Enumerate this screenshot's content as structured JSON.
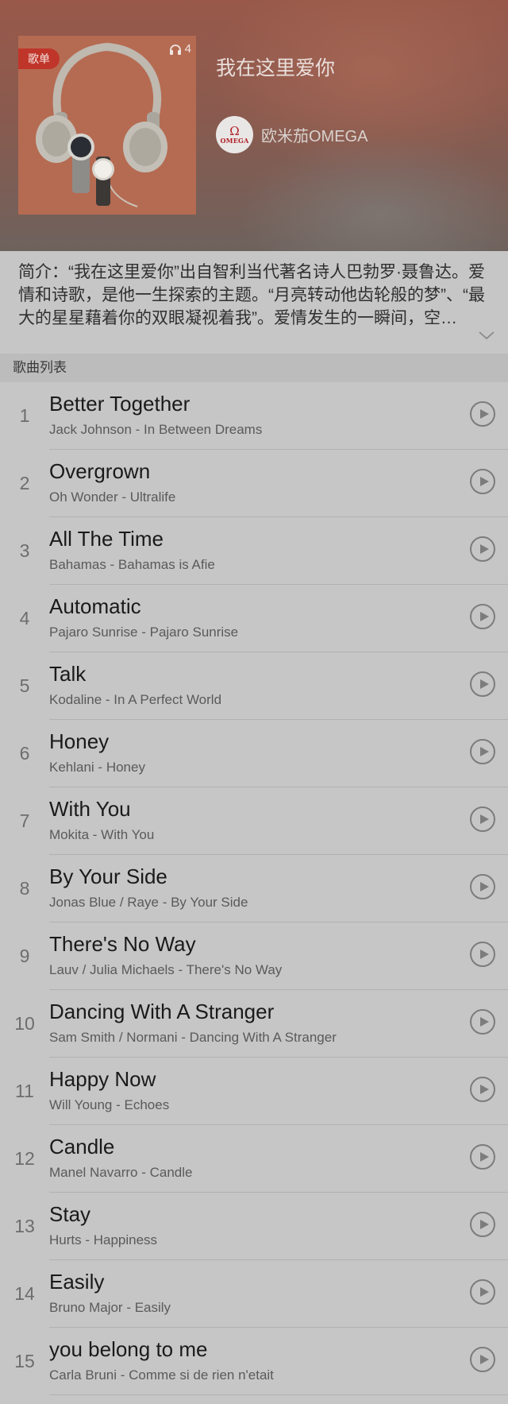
{
  "playlist": {
    "badge": "歌单",
    "listen_count": "4",
    "title": "我在这里爱你",
    "creator": "欧米茄OMEGA",
    "avatar_logo": "OMEGA",
    "description": "简介：“我在这里爱你”出自智利当代著名诗人巴勃罗·聂鲁达。爱情和诗歌，是他一生探索的主题。“月亮转动他齿轮般的梦”、“最大的星星藉着你的双眼凝视着我”。爱情发生的一瞬间，空…"
  },
  "section_title": "歌曲列表",
  "colors": {
    "header": "#98594a",
    "cover_bg": "#b26a52",
    "badge": "#c0352a"
  },
  "tracks": [
    {
      "num": "1",
      "name": "Better Together",
      "sub": "Jack Johnson - In Between Dreams"
    },
    {
      "num": "2",
      "name": "Overgrown",
      "sub": "Oh Wonder - Ultralife"
    },
    {
      "num": "3",
      "name": "All The Time",
      "sub": "Bahamas - Bahamas is Afie"
    },
    {
      "num": "4",
      "name": "Automatic",
      "sub": "Pajaro Sunrise - Pajaro Sunrise"
    },
    {
      "num": "5",
      "name": "Talk",
      "sub": "Kodaline - In A Perfect World"
    },
    {
      "num": "6",
      "name": "Honey",
      "sub": "Kehlani - Honey"
    },
    {
      "num": "7",
      "name": "With You",
      "sub": "Mokita - With You"
    },
    {
      "num": "8",
      "name": "By Your Side",
      "sub": "Jonas Blue / Raye - By Your Side"
    },
    {
      "num": "9",
      "name": "There's No Way",
      "sub": "Lauv / Julia Michaels - There's No Way"
    },
    {
      "num": "10",
      "name": "Dancing With A Stranger",
      "sub": "Sam Smith / Normani - Dancing With A Stranger"
    },
    {
      "num": "11",
      "name": "Happy Now",
      "sub": "Will Young - Echoes"
    },
    {
      "num": "12",
      "name": "Candle",
      "sub": "Manel Navarro - Candle"
    },
    {
      "num": "13",
      "name": "Stay",
      "sub": "Hurts - Happiness"
    },
    {
      "num": "14",
      "name": "Easily",
      "sub": "Bruno Major - Easily"
    },
    {
      "num": "15",
      "name": "you belong to me",
      "sub": "Carla Bruni - Comme si de rien n'etait"
    }
  ]
}
